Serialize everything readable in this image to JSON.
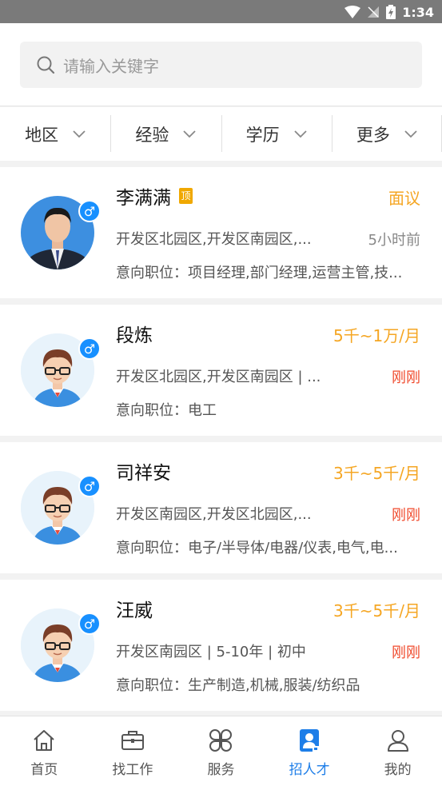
{
  "status_bar": {
    "time": "1:34"
  },
  "search": {
    "placeholder": "请输入关键字"
  },
  "filters": [
    {
      "label": "地区"
    },
    {
      "label": "经验"
    },
    {
      "label": "学历"
    },
    {
      "label": "更多"
    }
  ],
  "candidates": [
    {
      "name": "李满满",
      "top_badge": "顶",
      "salary": "面议",
      "location": "开发区北园区,开发区南园区,...",
      "time": "5小时前",
      "intent": "意向职位：项目经理,部门经理,运营主管,技...",
      "gender": "♂",
      "avatar": "photo"
    },
    {
      "name": "段炼",
      "salary": "5千~1万/月",
      "location": "开发区北园区,开发区南园区 | ...",
      "time": "刚刚",
      "intent": "意向职位：电工",
      "gender": "♂",
      "avatar": "cartoon"
    },
    {
      "name": "司祥安",
      "salary": "3千~5千/月",
      "location": "开发区南园区,开发区北园区,...",
      "time": "刚刚",
      "intent": "意向职位：电子/半导体/电器/仪表,电气,电...",
      "gender": "♂",
      "avatar": "cartoon"
    },
    {
      "name": "汪威",
      "salary": "3千~5千/月",
      "location": "开发区南园区 | 5-10年 | 初中",
      "time": "刚刚",
      "intent": "意向职位：生产制造,机械,服装/纺织品",
      "gender": "♂",
      "avatar": "cartoon"
    }
  ],
  "tabs": [
    {
      "label": "首页",
      "icon": "home-icon"
    },
    {
      "label": "找工作",
      "icon": "briefcase-icon"
    },
    {
      "label": "服务",
      "icon": "services-icon"
    },
    {
      "label": "招人才",
      "icon": "recruit-icon",
      "active": true
    },
    {
      "label": "我的",
      "icon": "profile-icon"
    }
  ],
  "colors": {
    "accent": "#1e7ee8",
    "salary": "#f5a623",
    "fresh": "#f04a2c",
    "gender": "#1890ff"
  }
}
